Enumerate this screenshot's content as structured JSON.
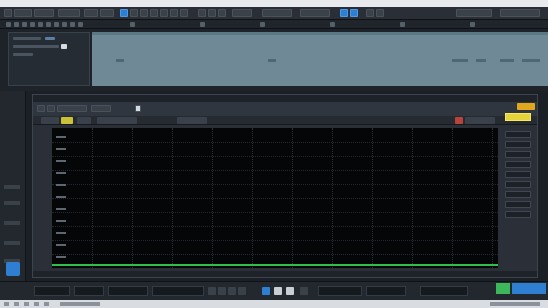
{
  "window": {
    "title": ""
  },
  "colors": {
    "accent_blue": "#2e7fd1",
    "analyzer_trace": "#2fbf4a",
    "highlight_yellow": "#e6d23a",
    "alert_red": "#b8433a",
    "track_region": "#6f8a96"
  },
  "toolbar": {
    "icons": [
      "menu-icon",
      "cursor-icon",
      "pencil-icon",
      "eraser-icon",
      "scissors-icon",
      "glue-icon",
      "mute-icon",
      "zoom-icon",
      "play-icon",
      "record-icon"
    ]
  },
  "arrange": {
    "track": {
      "name": "",
      "region_label": ""
    }
  },
  "analyzer": {
    "title": "",
    "tab_labels": [],
    "y_ticks": [],
    "x_ticks": [],
    "right_buttons": []
  },
  "transport": {
    "position": "",
    "tempo": "",
    "signature": ""
  }
}
